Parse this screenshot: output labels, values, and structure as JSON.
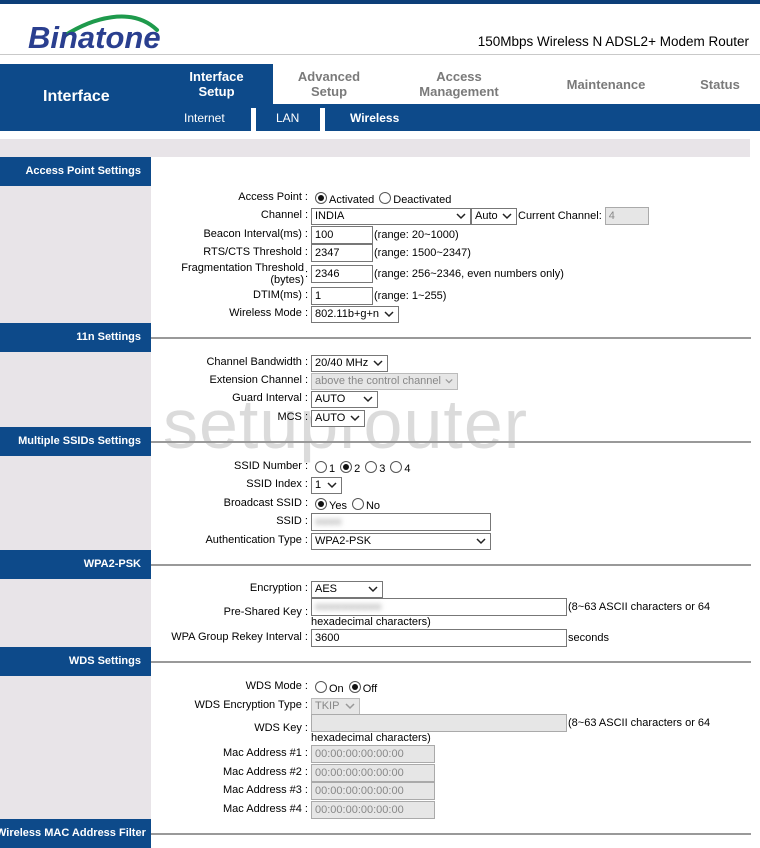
{
  "header": {
    "logo": "Binatone",
    "product": "150Mbps Wireless N ADSL2+ Modem Router"
  },
  "nav": {
    "section_title": "Interface",
    "tabs": [
      {
        "label": "Interface Setup",
        "active": true
      },
      {
        "label": "Advanced Setup",
        "active": false
      },
      {
        "label": "Access Management",
        "active": false
      },
      {
        "label": "Maintenance",
        "active": false
      },
      {
        "label": "Status",
        "active": false
      }
    ],
    "subtabs": [
      {
        "label": "Internet",
        "active": false
      },
      {
        "label": "LAN",
        "active": false
      },
      {
        "label": "Wireless",
        "active": true
      }
    ]
  },
  "watermark": "setuprouter",
  "access_point": {
    "title": "Access Point Settings",
    "access_point_label": "Access Point :",
    "activated": "Activated",
    "deactivated": "Deactivated",
    "channel_label": "Channel :",
    "channel_country": "INDIA",
    "channel_mode": "Auto",
    "current_channel_label": "Current Channel:",
    "current_channel": "4",
    "beacon_label": "Beacon Interval(ms) :",
    "beacon_value": "100",
    "beacon_note": "(range: 20~1000)",
    "rts_label": "RTS/CTS Threshold :",
    "rts_value": "2347",
    "rts_note": "(range: 1500~2347)",
    "frag_label_1": "Fragmentation Threshold",
    "frag_label_2": "(bytes)",
    "frag_colon": ":",
    "frag_value": "2346",
    "frag_note": "(range: 256~2346, even numbers only)",
    "dtim_label": "DTIM(ms) :",
    "dtim_value": "1",
    "dtim_note": "(range: 1~255)",
    "mode_label": "Wireless Mode :",
    "mode_value": "802.11b+g+n"
  },
  "n_settings": {
    "title": "11n Settings",
    "bandwidth_label": "Channel Bandwidth :",
    "bandwidth_value": "20/40 MHz",
    "ext_label": "Extension Channel :",
    "ext_value": "above the control channel",
    "guard_label": "Guard Interval :",
    "guard_value": "AUTO",
    "mcs_label": "MCS :",
    "mcs_value": "AUTO"
  },
  "ssids": {
    "title": "Multiple SSIDs Settings",
    "number_label": "SSID Number :",
    "numbers": [
      "1",
      "2",
      "3",
      "4"
    ],
    "selected_number": "2",
    "index_label": "SSID Index :",
    "index_value": "1",
    "broadcast_label": "Broadcast SSID :",
    "yes": "Yes",
    "no": "No",
    "ssid_label": "SSID :",
    "ssid_value": "●●●●",
    "auth_label": "Authentication Type :",
    "auth_value": "WPA2-PSK"
  },
  "wpa2": {
    "title": "WPA2-PSK",
    "enc_label": "Encryption :",
    "enc_value": "AES",
    "psk_label": "Pre-Shared Key :",
    "psk_value": "●●●●●●●●●●",
    "psk_note_1": "(8~63 ASCII characters or 64",
    "psk_note_2": "hexadecimal characters)",
    "rekey_label": "WPA Group Rekey Interval :",
    "rekey_value": "3600",
    "rekey_unit": "seconds"
  },
  "wds": {
    "title": "WDS Settings",
    "mode_label": "WDS Mode :",
    "on": "On",
    "off": "Off",
    "enc_label": "WDS Encryption Type :",
    "enc_value": "TKIP",
    "key_label": "WDS Key :",
    "key_value": "",
    "key_note_1": "(8~63 ASCII characters or 64",
    "key_note_2": "hexadecimal characters)",
    "macs": [
      {
        "label": "Mac Address #1 :",
        "value": "00:00:00:00:00:00"
      },
      {
        "label": "Mac Address #2 :",
        "value": "00:00:00:00:00:00"
      },
      {
        "label": "Mac Address #3 :",
        "value": "00:00:00:00:00:00"
      },
      {
        "label": "Mac Address #4 :",
        "value": "00:00:00:00:00:00"
      }
    ]
  },
  "mac_filter": {
    "title": "Wireless MAC Address Filter"
  }
}
